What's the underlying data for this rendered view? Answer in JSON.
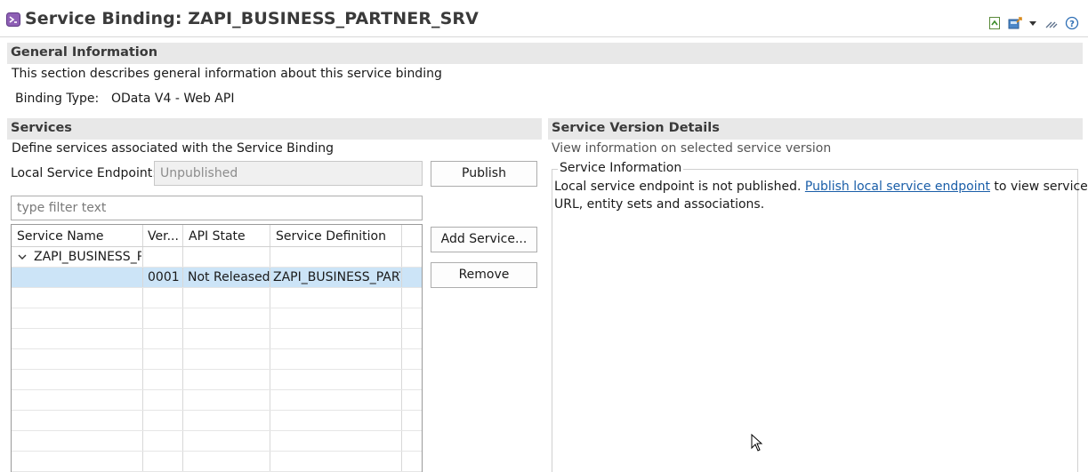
{
  "window": {
    "title": "Service Binding: ZAPI_BUSINESS_PARTNER_SRV",
    "toolbar_icons": [
      "export-icon",
      "publish-icon",
      "dropdown-arrow-icon",
      "edit-icon",
      "help-icon"
    ]
  },
  "general": {
    "title": "General Information",
    "description": "This section describes general information about this service binding",
    "binding_type_label": "Binding Type:",
    "binding_type_value": "OData V4 - Web API"
  },
  "services": {
    "title": "Services",
    "description": "Define services associated with the Service Binding",
    "endpoint_label": "Local Service Endpoint:",
    "endpoint_value": "Unpublished",
    "publish_button": "Publish",
    "filter_placeholder": "type filter text",
    "add_button": "Add Service...",
    "remove_button": "Remove",
    "columns": [
      "Service Name",
      "Ver...",
      "API State",
      "Service Definition"
    ],
    "tree_parent": "ZAPI_BUSINESS_PARTNER_SRV",
    "rows": [
      {
        "version": "0001",
        "api_state": "Not Released",
        "definition": "ZAPI_BUSINESS_PARTNER"
      }
    ]
  },
  "details": {
    "title": "Service Version Details",
    "description": "View information on selected service version",
    "group_label": "Service Information",
    "msg_before": "Local service endpoint is not published. ",
    "msg_link": "Publish local service endpoint",
    "msg_after": " to view service",
    "msg_line2": "URL, entity sets and associations."
  },
  "colors": {
    "header_bg": "#e8e8e8",
    "selection": "#cce4f7",
    "link": "#1a5ea8"
  }
}
